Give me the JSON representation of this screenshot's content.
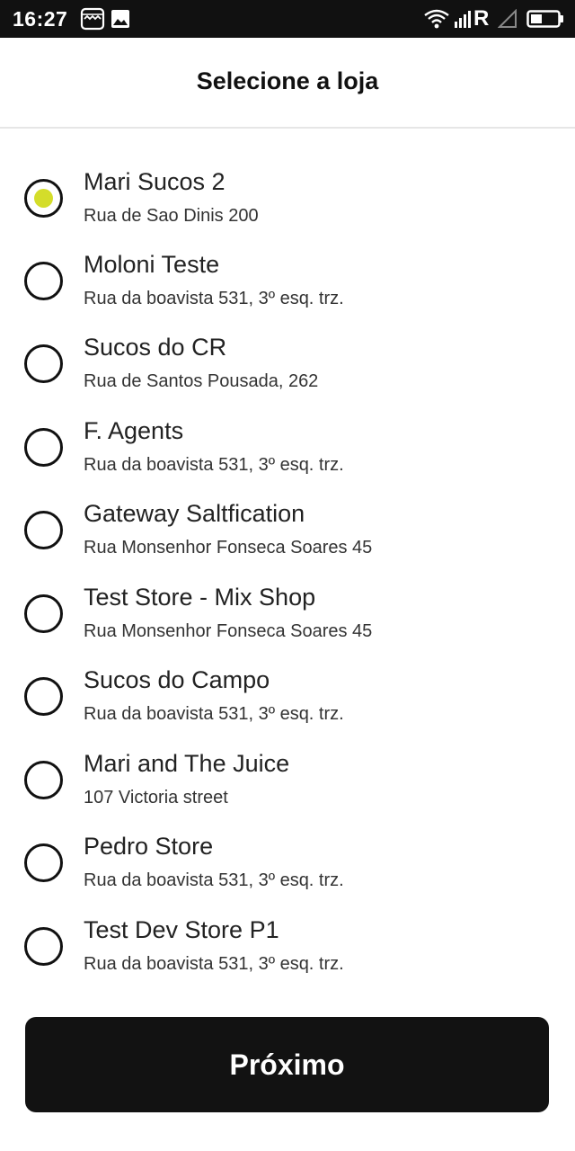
{
  "status_bar": {
    "time": "16:27",
    "icons": [
      "notification-icon",
      "image-icon",
      "wifi-icon",
      "signal-icon",
      "roaming-icon",
      "signal-empty-icon",
      "battery-icon"
    ],
    "roaming_label": "R"
  },
  "header": {
    "title": "Selecione a loja"
  },
  "stores": [
    {
      "name": "Mari Sucos 2",
      "address": "Rua de Sao Dinis 200",
      "selected": true
    },
    {
      "name": "Moloni Teste",
      "address": "Rua da boavista 531, 3º esq. trz.",
      "selected": false
    },
    {
      "name": "Sucos do CR",
      "address": "Rua de Santos Pousada, 262",
      "selected": false
    },
    {
      "name": "F. Agents",
      "address": "Rua da boavista 531, 3º esq. trz.",
      "selected": false
    },
    {
      "name": "Gateway Saltfication",
      "address": "Rua Monsenhor Fonseca Soares 45",
      "selected": false
    },
    {
      "name": "Test Store - Mix Shop",
      "address": "Rua Monsenhor Fonseca Soares 45",
      "selected": false
    },
    {
      "name": "Sucos do Campo",
      "address": "Rua da boavista 531, 3º esq. trz.",
      "selected": false
    },
    {
      "name": "Mari and The Juice",
      "address": "107 Victoria street",
      "selected": false
    },
    {
      "name": "Pedro Store",
      "address": "Rua da boavista 531, 3º esq. trz.",
      "selected": false
    },
    {
      "name": "Test Dev Store P1",
      "address": "Rua da boavista 531, 3º esq. trz.",
      "selected": false
    }
  ],
  "footer": {
    "next_label": "Próximo"
  },
  "colors": {
    "accent": "#d4dd2a",
    "button_bg": "#121212",
    "status_bar_bg": "#111111"
  }
}
